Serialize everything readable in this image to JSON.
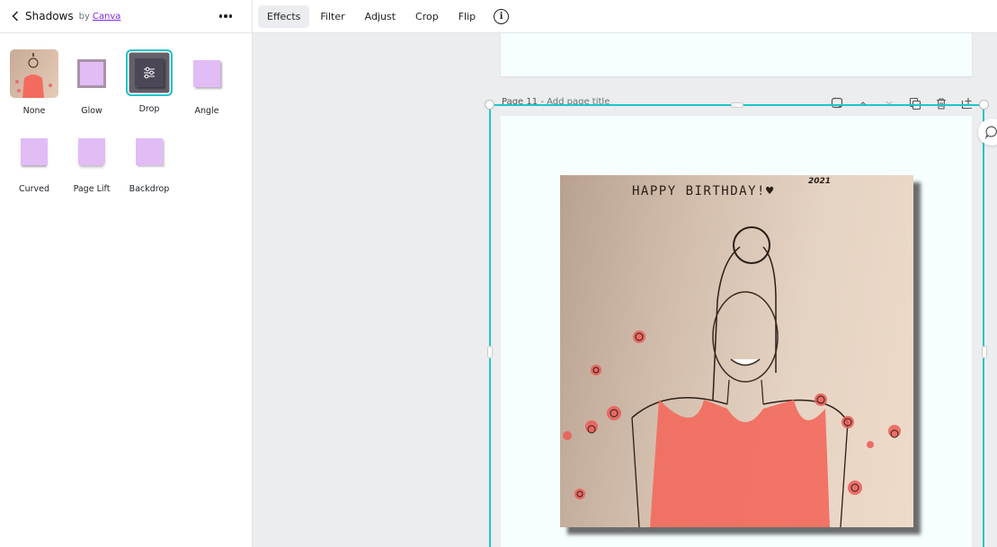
{
  "panel": {
    "title": "Shadows",
    "by": "by",
    "author": "Canva",
    "options": [
      {
        "label": "None",
        "icon": "photo-thumbnail",
        "selected": false
      },
      {
        "label": "Glow",
        "icon": "glow-shadow-icon",
        "selected": false
      },
      {
        "label": "Drop",
        "icon": "sliders-icon",
        "selected": true
      },
      {
        "label": "Angle",
        "icon": "angle-shadow-icon",
        "selected": false
      },
      {
        "label": "Curved",
        "icon": "curved-shadow-icon",
        "selected": false
      },
      {
        "label": "Page Lift",
        "icon": "page-lift-shadow-icon",
        "selected": false
      },
      {
        "label": "Backdrop",
        "icon": "backdrop-shadow-icon",
        "selected": false
      }
    ]
  },
  "toolbar": {
    "items": [
      "Effects",
      "Filter",
      "Adjust",
      "Crop",
      "Flip"
    ],
    "active": "Effects",
    "info_glyph": "i"
  },
  "canvas": {
    "page_label": "Page 11",
    "page_title_placeholder": "- Add page title",
    "photo_text": "HAPPY BIRTHDAY!♥",
    "photo_year": "2021"
  },
  "colors": {
    "accent": "#20c4cb",
    "link": "#7d2ae8",
    "swatch": "#e1bcf5"
  }
}
